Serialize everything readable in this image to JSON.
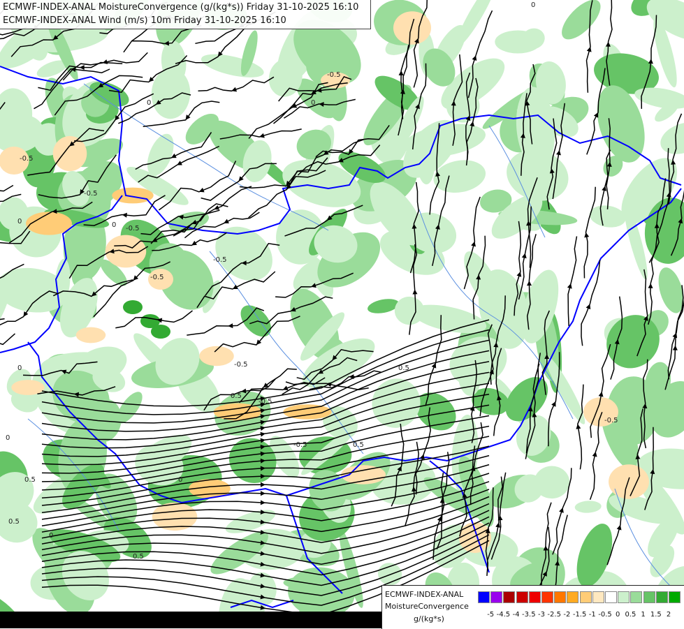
{
  "title": {
    "line1": "ECMWF-INDEX-ANAL MoistureConvergence (g/(kg*s)) Friday 31-10-2025 16:10",
    "line2": "ECMWF-INDEX-ANAL Wind (m/s) 10m Friday 31-10-2025 16:10"
  },
  "legend": {
    "model": "ECMWF-INDEX-ANAL",
    "parameter": "MoistureConvergence",
    "unit": "g/(kg*s)",
    "colors": [
      "#0000ff",
      "#9900ee",
      "#aa0000",
      "#cc0000",
      "#ee0000",
      "#ff3300",
      "#ff7700",
      "#ffaa22",
      "#ffcc77",
      "#ffe8c0",
      "#ffffff",
      "#ccf0cc",
      "#9adc9a",
      "#66c466",
      "#33aa33",
      "#00aa00"
    ],
    "ticks": [
      "-5",
      "-4.5",
      "-4",
      "-3.5",
      "-3",
      "-2.5",
      "-2",
      "-1.5",
      "-1",
      "-0.5",
      "0",
      "0.5",
      "1",
      "1.5",
      "2"
    ]
  },
  "contour_labels": [
    "-0.5",
    "-0.5",
    "-0.5",
    "-0.5",
    "-0.5",
    "-0.5",
    "-0.5",
    "-0.5",
    "0.5",
    "0.5",
    "-0.5",
    "-0.5",
    "0.5",
    "0",
    "0",
    "0",
    "0",
    "0",
    "0",
    "0.5",
    "0",
    "0",
    "0.5",
    "0",
    "0.5"
  ],
  "colors": {
    "border": "#0000ff",
    "river": "#5a8fe0",
    "streamline": "#000000"
  }
}
